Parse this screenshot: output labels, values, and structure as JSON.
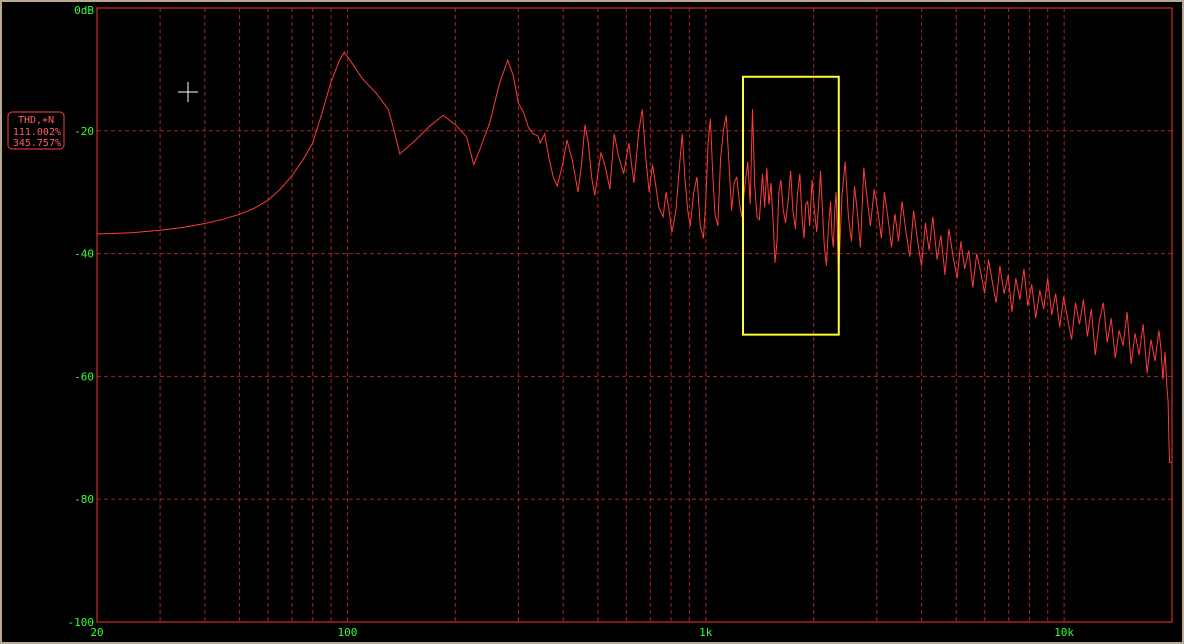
{
  "badge": {
    "label": "THD,+N",
    "value1": "111.002%",
    "value2": "345.757%"
  },
  "chart_data": {
    "type": "line",
    "x_scale": "log",
    "xlim": [
      20,
      20000
    ],
    "ylim": [
      -100,
      0
    ],
    "y_ticks": [
      {
        "value": 0,
        "label": "0dB"
      },
      {
        "value": -20,
        "label": "-20"
      },
      {
        "value": -40,
        "label": "-40"
      },
      {
        "value": -60,
        "label": "-60"
      },
      {
        "value": -80,
        "label": "-80"
      },
      {
        "value": -100,
        "label": "-100"
      }
    ],
    "x_ticks": [
      {
        "value": 20,
        "label": "20"
      },
      {
        "value": 100,
        "label": "100"
      },
      {
        "value": 1000,
        "label": "1k"
      },
      {
        "value": 10000,
        "label": "10k"
      }
    ],
    "grid": true,
    "colors": {
      "background": "#000000",
      "axis": "#ff3333",
      "grid": "#aa2222",
      "trace": "#ff3a3a",
      "tick_text": "#33ff33",
      "highlight": "#ffff33"
    },
    "highlight_box": {
      "x_range": [
        1270,
        2350
      ],
      "y_range": [
        -53.2,
        -11.2
      ]
    },
    "series": [
      {
        "values": [
          [
            20,
            -36.8
          ],
          [
            25,
            -36.6
          ],
          [
            30,
            -36.2
          ],
          [
            35,
            -35.7
          ],
          [
            40,
            -35.1
          ],
          [
            45,
            -34.4
          ],
          [
            50,
            -33.6
          ],
          [
            55,
            -32.6
          ],
          [
            60,
            -31.3
          ],
          [
            65,
            -29.5
          ],
          [
            70,
            -27.3
          ],
          [
            75,
            -24.8
          ],
          [
            80,
            -22.0
          ],
          [
            85,
            -17.0
          ],
          [
            90,
            -12.0
          ],
          [
            95,
            -8.5
          ],
          [
            98,
            -7.2
          ],
          [
            102,
            -8.6
          ],
          [
            110,
            -11.5
          ],
          [
            120,
            -13.8
          ],
          [
            130,
            -16.5
          ],
          [
            135,
            -20.0
          ],
          [
            140,
            -23.8
          ],
          [
            155,
            -21.5
          ],
          [
            170,
            -19.2
          ],
          [
            185,
            -17.5
          ],
          [
            200,
            -19.0
          ],
          [
            215,
            -21.0
          ],
          [
            225,
            -25.5
          ],
          [
            235,
            -22.8
          ],
          [
            250,
            -18.5
          ],
          [
            265,
            -12.5
          ],
          [
            280,
            -8.5
          ],
          [
            290,
            -11.0
          ],
          [
            300,
            -15.5
          ],
          [
            310,
            -17.0
          ],
          [
            320,
            -19.5
          ],
          [
            330,
            -20.5
          ],
          [
            340,
            -20.8
          ],
          [
            345,
            -22.0
          ],
          [
            355,
            -20.5
          ],
          [
            365,
            -24.5
          ],
          [
            375,
            -27.5
          ],
          [
            385,
            -29.0
          ],
          [
            400,
            -25.0
          ],
          [
            410,
            -21.5
          ],
          [
            425,
            -25.0
          ],
          [
            440,
            -30.0
          ],
          [
            450,
            -25.5
          ],
          [
            460,
            -19.0
          ],
          [
            470,
            -22.0
          ],
          [
            480,
            -27.5
          ],
          [
            490,
            -30.5
          ],
          [
            510,
            -23.5
          ],
          [
            525,
            -26.0
          ],
          [
            540,
            -29.5
          ],
          [
            555,
            -20.5
          ],
          [
            570,
            -24.0
          ],
          [
            590,
            -27.0
          ],
          [
            610,
            -22.0
          ],
          [
            630,
            -28.5
          ],
          [
            650,
            -20.0
          ],
          [
            665,
            -16.5
          ],
          [
            680,
            -24.5
          ],
          [
            695,
            -30.0
          ],
          [
            710,
            -25.5
          ],
          [
            725,
            -29.0
          ],
          [
            740,
            -32.5
          ],
          [
            760,
            -34.0
          ],
          [
            775,
            -30.0
          ],
          [
            790,
            -33.0
          ],
          [
            805,
            -36.5
          ],
          [
            825,
            -33.0
          ],
          [
            845,
            -25.5
          ],
          [
            860,
            -20.5
          ],
          [
            875,
            -28.0
          ],
          [
            890,
            -33.0
          ],
          [
            905,
            -35.5
          ],
          [
            925,
            -30.0
          ],
          [
            945,
            -27.5
          ],
          [
            965,
            -35.5
          ],
          [
            985,
            -37.5
          ],
          [
            1000,
            -31.5
          ],
          [
            1015,
            -22.0
          ],
          [
            1030,
            -18.0
          ],
          [
            1045,
            -26.5
          ],
          [
            1060,
            -33.5
          ],
          [
            1080,
            -35.5
          ],
          [
            1100,
            -24.5
          ],
          [
            1120,
            -20.0
          ],
          [
            1140,
            -17.5
          ],
          [
            1160,
            -25.0
          ],
          [
            1180,
            -33.0
          ],
          [
            1200,
            -28.5
          ],
          [
            1220,
            -27.5
          ],
          [
            1240,
            -31.5
          ],
          [
            1260,
            -34.0
          ],
          [
            1280,
            -30.0
          ],
          [
            1310,
            -25.0
          ],
          [
            1330,
            -32.0
          ],
          [
            1350,
            -16.5
          ],
          [
            1370,
            -29.0
          ],
          [
            1390,
            -34.0
          ],
          [
            1410,
            -34.5
          ],
          [
            1440,
            -27.0
          ],
          [
            1460,
            -32.5
          ],
          [
            1480,
            -26.0
          ],
          [
            1500,
            -32.0
          ],
          [
            1520,
            -28.5
          ],
          [
            1545,
            -36.0
          ],
          [
            1560,
            -41.5
          ],
          [
            1580,
            -38.0
          ],
          [
            1600,
            -30.0
          ],
          [
            1620,
            -28.0
          ],
          [
            1645,
            -33.0
          ],
          [
            1670,
            -35.0
          ],
          [
            1700,
            -31.0
          ],
          [
            1725,
            -26.5
          ],
          [
            1750,
            -33.0
          ],
          [
            1780,
            -36.0
          ],
          [
            1800,
            -30.5
          ],
          [
            1830,
            -27.0
          ],
          [
            1855,
            -34.0
          ],
          [
            1880,
            -37.5
          ],
          [
            1900,
            -32.0
          ],
          [
            1925,
            -31.5
          ],
          [
            1950,
            -35.5
          ],
          [
            1980,
            -28.0
          ],
          [
            2010,
            -33.0
          ],
          [
            2040,
            -36.5
          ],
          [
            2070,
            -31.0
          ],
          [
            2090,
            -26.5
          ],
          [
            2110,
            -31.5
          ],
          [
            2140,
            -38.5
          ],
          [
            2170,
            -42.0
          ],
          [
            2200,
            -35.5
          ],
          [
            2230,
            -31.5
          ],
          [
            2250,
            -37.0
          ],
          [
            2270,
            -39.0
          ],
          [
            2290,
            -33.0
          ],
          [
            2310,
            -30.0
          ],
          [
            2330,
            -36.5
          ],
          [
            2345,
            -44.5
          ],
          [
            2360,
            -40.5
          ],
          [
            2400,
            -30.5
          ],
          [
            2450,
            -25.0
          ],
          [
            2500,
            -34.0
          ],
          [
            2550,
            -38.0
          ],
          [
            2600,
            -29.0
          ],
          [
            2650,
            -33.5
          ],
          [
            2700,
            -39.0
          ],
          [
            2760,
            -26.0
          ],
          [
            2820,
            -31.0
          ],
          [
            2880,
            -35.5
          ],
          [
            2950,
            -29.5
          ],
          [
            3020,
            -33.0
          ],
          [
            3090,
            -37.5
          ],
          [
            3150,
            -30.0
          ],
          [
            3220,
            -34.0
          ],
          [
            3300,
            -39.0
          ],
          [
            3370,
            -33.5
          ],
          [
            3450,
            -38.0
          ],
          [
            3530,
            -31.5
          ],
          [
            3620,
            -36.5
          ],
          [
            3710,
            -40.5
          ],
          [
            3800,
            -33.0
          ],
          [
            3900,
            -38.0
          ],
          [
            4000,
            -42.0
          ],
          [
            4100,
            -35.0
          ],
          [
            4200,
            -39.5
          ],
          [
            4300,
            -34.0
          ],
          [
            4420,
            -41.0
          ],
          [
            4530,
            -37.0
          ],
          [
            4650,
            -43.5
          ],
          [
            4770,
            -36.0
          ],
          [
            4900,
            -40.5
          ],
          [
            5030,
            -44.0
          ],
          [
            5150,
            -38.0
          ],
          [
            5280,
            -42.5
          ],
          [
            5420,
            -39.5
          ],
          [
            5560,
            -45.5
          ],
          [
            5700,
            -40.0
          ],
          [
            5850,
            -43.0
          ],
          [
            6000,
            -46.5
          ],
          [
            6150,
            -41.0
          ],
          [
            6300,
            -44.5
          ],
          [
            6460,
            -48.0
          ],
          [
            6620,
            -42.0
          ],
          [
            6800,
            -46.5
          ],
          [
            6980,
            -43.5
          ],
          [
            7150,
            -49.5
          ],
          [
            7330,
            -44.0
          ],
          [
            7520,
            -47.5
          ],
          [
            7720,
            -42.5
          ],
          [
            7920,
            -48.5
          ],
          [
            8120,
            -45.0
          ],
          [
            8330,
            -50.5
          ],
          [
            8550,
            -46.0
          ],
          [
            8770,
            -49.0
          ],
          [
            9000,
            -44.0
          ],
          [
            9230,
            -50.0
          ],
          [
            9470,
            -46.5
          ],
          [
            9720,
            -52.0
          ],
          [
            9970,
            -47.0
          ],
          [
            10220,
            -50.5
          ],
          [
            10490,
            -54.0
          ],
          [
            10760,
            -48.0
          ],
          [
            11040,
            -51.5
          ],
          [
            11320,
            -47.5
          ],
          [
            11610,
            -53.5
          ],
          [
            11910,
            -49.0
          ],
          [
            12220,
            -56.5
          ],
          [
            12540,
            -51.0
          ],
          [
            12860,
            -48.0
          ],
          [
            13190,
            -54.5
          ],
          [
            13530,
            -50.5
          ],
          [
            13880,
            -57.0
          ],
          [
            14240,
            -52.5
          ],
          [
            14610,
            -55.0
          ],
          [
            14990,
            -49.5
          ],
          [
            15380,
            -58.0
          ],
          [
            15780,
            -53.0
          ],
          [
            16190,
            -56.5
          ],
          [
            16610,
            -51.5
          ],
          [
            17040,
            -59.5
          ],
          [
            17480,
            -54.0
          ],
          [
            17930,
            -57.5
          ],
          [
            18390,
            -52.5
          ],
          [
            18630,
            -55.5
          ],
          [
            18870,
            -60.5
          ],
          [
            19120,
            -56.0
          ],
          [
            19370,
            -62.0
          ],
          [
            19500,
            -64.0
          ],
          [
            19600,
            -70.5
          ],
          [
            19700,
            -74.0
          ],
          [
            20000,
            -74.0
          ]
        ]
      }
    ]
  }
}
